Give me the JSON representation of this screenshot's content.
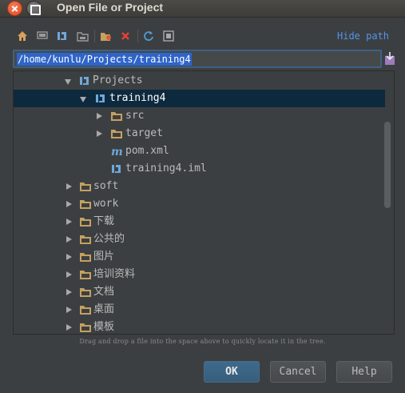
{
  "window": {
    "title": "Open File or Project",
    "controls": [
      "close-icon",
      "maximize-icon"
    ]
  },
  "toolbar": {
    "icons": [
      "home-icon",
      "desktop-icon",
      "project-icon",
      "module-folder-icon",
      "new-folder-icon",
      "delete-icon",
      "refresh-icon",
      "show-hidden-icon"
    ],
    "hide_path_label": "Hide path"
  },
  "path_field": {
    "value": "/home/kunlu/Projects/training4"
  },
  "tree": {
    "items": [
      {
        "label": "Projects",
        "icon": "project-icon",
        "expanded": true,
        "depth": 0
      },
      {
        "label": "training4",
        "icon": "project-icon",
        "expanded": true,
        "selected": true,
        "depth": 1
      },
      {
        "label": "src",
        "icon": "folder-icon",
        "expanded": false,
        "depth": 2
      },
      {
        "label": "target",
        "icon": "folder-icon",
        "expanded": false,
        "depth": 2
      },
      {
        "label": "pom.xml",
        "icon": "maven-file-icon",
        "depth": 2
      },
      {
        "label": "training4.iml",
        "icon": "iml-file-icon",
        "depth": 2
      },
      {
        "label": "soft",
        "icon": "folder-icon",
        "expanded": false,
        "depth": -1
      },
      {
        "label": "work",
        "icon": "folder-icon",
        "expanded": false,
        "depth": -1
      },
      {
        "label": "下载",
        "icon": "folder-icon",
        "expanded": false,
        "depth": -1
      },
      {
        "label": "公共的",
        "icon": "folder-icon",
        "expanded": false,
        "depth": -1
      },
      {
        "label": "图片",
        "icon": "folder-icon",
        "expanded": false,
        "depth": -1
      },
      {
        "label": "培训资料",
        "icon": "folder-icon",
        "expanded": false,
        "depth": -1
      },
      {
        "label": "文档",
        "icon": "folder-icon",
        "expanded": false,
        "depth": -1
      },
      {
        "label": "桌面",
        "icon": "folder-icon",
        "expanded": false,
        "depth": -1
      },
      {
        "label": "模板",
        "icon": "folder-icon",
        "expanded": false,
        "depth": -1
      }
    ]
  },
  "hint": "Drag and drop a file into the space above to quickly locate it in the tree.",
  "buttons": {
    "ok": "OK",
    "cancel": "Cancel",
    "help": "Help"
  },
  "colors": {
    "background": "#3c3f41",
    "selection": "#0d293e",
    "link": "#5394ec",
    "folder": "#c5a15f",
    "project_icon": "#6fa8dc",
    "text_selection": "#2f65ca"
  }
}
